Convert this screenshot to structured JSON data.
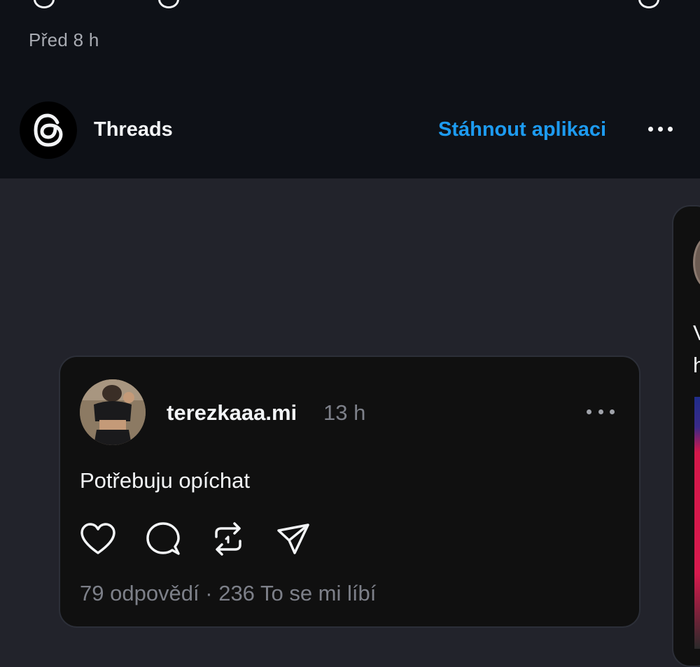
{
  "story": {
    "time_label": "Před 8 h"
  },
  "header": {
    "logo_icon": "threads-logo-icon",
    "brand_name": "Threads",
    "download_label": "Stáhnout aplikaci",
    "accent_color": "#1d9bf0"
  },
  "post": {
    "username": "terezkaaa.mi",
    "age": "13 h",
    "text": "Potřebuju opíchat",
    "stats": "79 odpovědí · 236 To se mi líbí",
    "actions": [
      "heart-icon",
      "comment-icon",
      "repost-icon",
      "share-icon"
    ]
  },
  "next_post": {
    "text_line1": "V",
    "text_line2": "h"
  }
}
